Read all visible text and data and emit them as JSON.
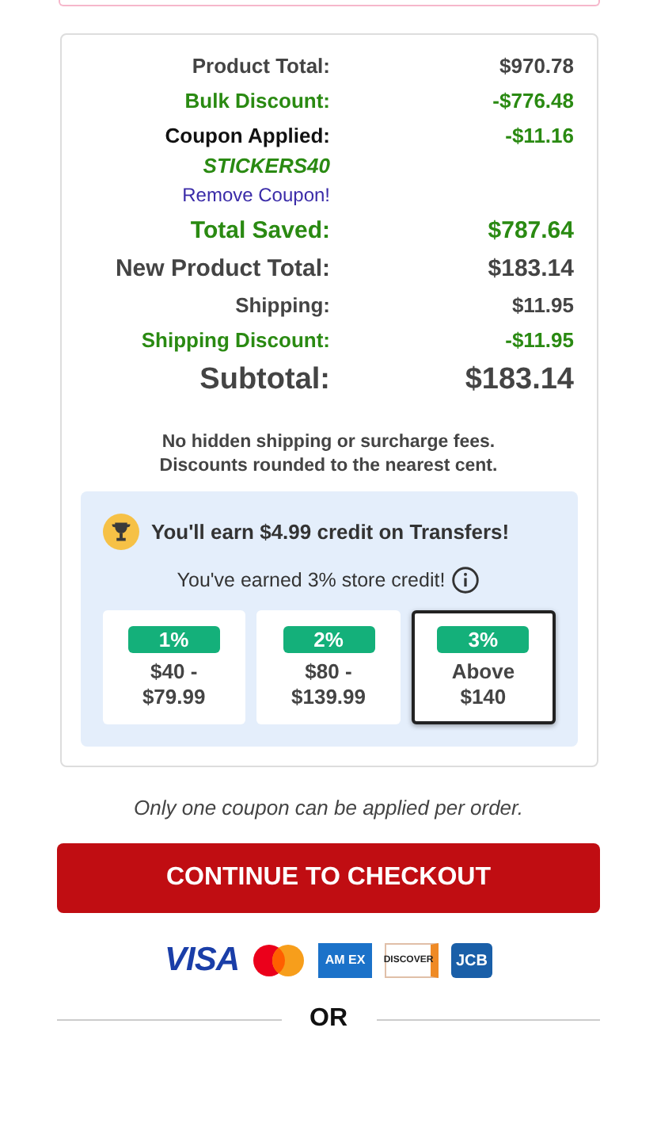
{
  "summary": {
    "rows": [
      {
        "kind": "normal",
        "label": "Product Total:",
        "value": "$970.78"
      },
      {
        "kind": "discount",
        "label": "Bulk Discount:",
        "value": "-$776.48"
      },
      {
        "kind": "coupon",
        "label": "Coupon Applied:",
        "value": "-$11.16",
        "code": "STICKERS40",
        "remove_link": "Remove Coupon!"
      },
      {
        "kind": "saved",
        "label": "Total Saved:",
        "value": "$787.64"
      },
      {
        "kind": "emphasis",
        "label": "New Product Total:",
        "value": "$183.14"
      },
      {
        "kind": "normal",
        "label": "Shipping:",
        "value": "$11.95"
      },
      {
        "kind": "discount",
        "label": "Shipping Discount:",
        "value": "-$11.95"
      },
      {
        "kind": "subtotal",
        "label": "Subtotal:",
        "value": "$183.14"
      }
    ],
    "notes": [
      "No hidden shipping or surcharge fees.",
      "Discounts rounded to the nearest cent."
    ],
    "credit": {
      "headline": "You'll earn $4.99 credit on Transfers!",
      "earned": "You've earned 3% store credit!",
      "tiers": [
        {
          "percent": "1%",
          "range": "$40 -\n$79.99",
          "selected": false
        },
        {
          "percent": "2%",
          "range": "$80 -\n$139.99",
          "selected": false
        },
        {
          "percent": "3%",
          "range": "Above\n$140",
          "selected": true
        }
      ]
    }
  },
  "coupon_note": "Only one coupon can be applied per order.",
  "checkout_button": "CONTINUE TO CHECKOUT",
  "payment_logos": [
    {
      "kind": "visa",
      "text": "VISA"
    },
    {
      "kind": "mastercard"
    },
    {
      "kind": "amex",
      "text": "AM EX"
    },
    {
      "kind": "discover",
      "text": "DISCOVER"
    },
    {
      "kind": "jcb",
      "text": "JCB"
    }
  ],
  "divider_text": "OR"
}
